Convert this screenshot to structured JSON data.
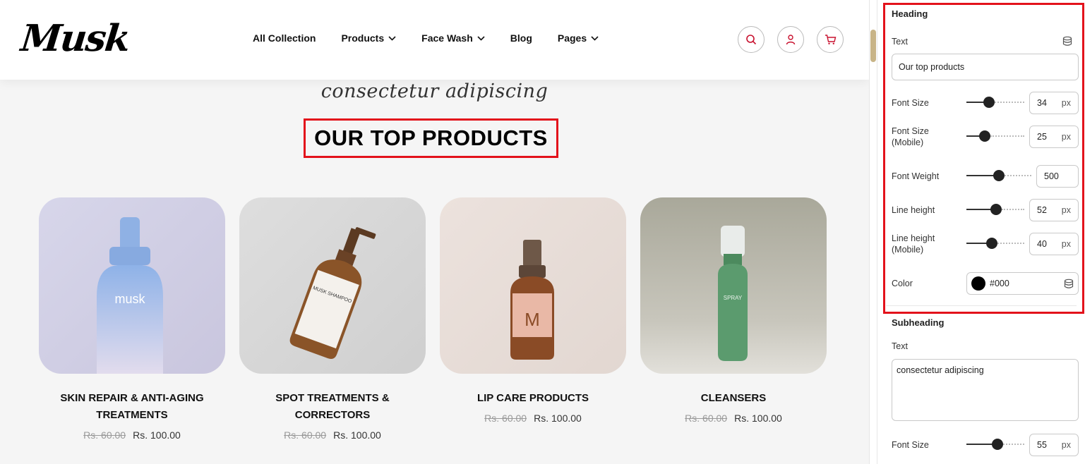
{
  "store": {
    "logo": "Musk",
    "nav": [
      {
        "label": "All Collection",
        "dropdown": false
      },
      {
        "label": "Products",
        "dropdown": true
      },
      {
        "label": "Face Wash",
        "dropdown": true
      },
      {
        "label": "Blog",
        "dropdown": false
      },
      {
        "label": "Pages",
        "dropdown": true
      }
    ],
    "icons": [
      "search-icon",
      "user-icon",
      "cart-icon"
    ],
    "accent_color": "#c8102e"
  },
  "section": {
    "subheading": "consectetur adipiscing",
    "heading": "Our top products"
  },
  "products": [
    {
      "title": "SKIN REPAIR & ANTI-AGING TREATMENTS",
      "old_price": "Rs. 60.00",
      "price": "Rs. 100.00",
      "bottle_label": "musk"
    },
    {
      "title": "SPOT TREATMENTS & CORRECTORS",
      "old_price": "Rs. 60.00",
      "price": "Rs. 100.00",
      "bottle_label": "MUSK SHAMPOO"
    },
    {
      "title": "LIP CARE PRODUCTS",
      "old_price": "Rs. 60.00",
      "price": "Rs. 100.00",
      "bottle_label": "M"
    },
    {
      "title": "CLEANSERS",
      "old_price": "Rs. 60.00",
      "price": "Rs. 100.00",
      "bottle_label": "SPRAY"
    }
  ],
  "panel": {
    "heading_section": {
      "title": "Heading",
      "text_label": "Text",
      "text_value": "Our top products",
      "font_size": {
        "label": "Font Size",
        "value": "34",
        "unit": "px",
        "level": 0.37
      },
      "font_size_mobile": {
        "label": "Font Size\n(Mobile)",
        "value": "25",
        "unit": "px",
        "level": 0.28
      },
      "font_weight": {
        "label": "Font Weight",
        "value": "500",
        "level": 0.5
      },
      "line_height": {
        "label": "Line height",
        "value": "52",
        "unit": "px",
        "level": 0.52
      },
      "line_height_mobile": {
        "label": "Line height\n(Mobile)",
        "value": "40",
        "unit": "px",
        "level": 0.42
      },
      "color": {
        "label": "Color",
        "value": "#000"
      }
    },
    "subheading_section": {
      "title": "Subheading",
      "text_label": "Text",
      "text_value": "consectetur adipiscing",
      "font_size": {
        "label": "Font Size",
        "value": "55",
        "unit": "px",
        "level": 0.55
      }
    }
  }
}
